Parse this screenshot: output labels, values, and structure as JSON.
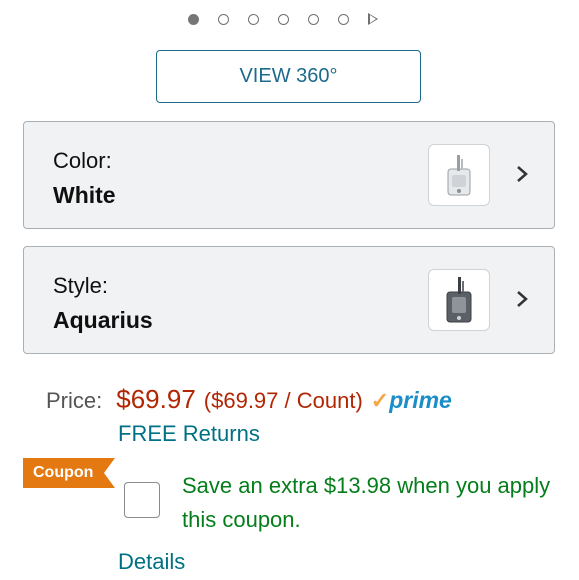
{
  "carousel": {
    "dot_count": 6,
    "active_index": 0
  },
  "view360": {
    "label": "VIEW 360°"
  },
  "variants": [
    {
      "label": "Color:",
      "value": "White",
      "thumb_icon": "water-flosser-white"
    },
    {
      "label": "Style:",
      "value": "Aquarius",
      "thumb_icon": "water-flosser-gray"
    }
  ],
  "price": {
    "label": "Price:",
    "amount": "$69.97",
    "unit_price": "($69.97 / Count)",
    "prime_check": "✓",
    "prime_word": "prime"
  },
  "returns": {
    "label": "FREE Returns"
  },
  "coupon": {
    "badge": "Coupon",
    "text": "Save an extra $13.98 when you apply this coupon.",
    "details": "Details"
  },
  "colors": {
    "link": "#007185",
    "price": "#b12704",
    "coupon_green": "#067d1b",
    "coupon_badge": "#e47911",
    "prime_blue": "#1c8ec7"
  }
}
